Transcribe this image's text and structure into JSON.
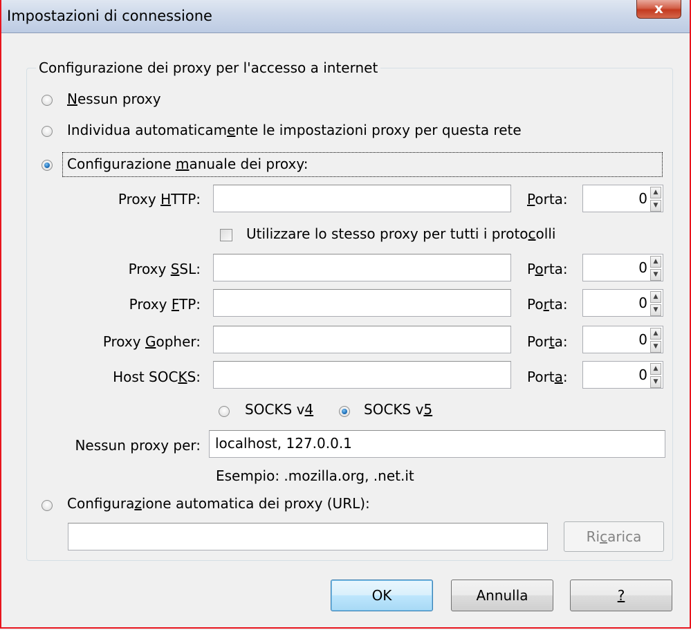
{
  "window": {
    "title": "Impostazioni di connessione",
    "close_glyph": "x"
  },
  "group": {
    "legend": "Configurazione dei proxy per l'accesso a internet"
  },
  "options": {
    "no_proxy": {
      "pre": "",
      "key": "N",
      "post": "essun proxy",
      "checked": false
    },
    "auto_detect": {
      "pre": "Individua automaticam",
      "key": "e",
      "post": "nte le impostazioni proxy per questa rete",
      "checked": false
    },
    "manual": {
      "pre": "Configurazione ",
      "key": "m",
      "post": "anuale dei proxy:",
      "checked": true
    },
    "auto_url": {
      "pre": "Configura",
      "key": "z",
      "post": "ione automatica dei proxy (URL):",
      "checked": false
    }
  },
  "proxies": {
    "http": {
      "label_pre": "Proxy ",
      "label_key": "H",
      "label_post": "TTP:",
      "value": "",
      "port_pre": "",
      "port_key": "P",
      "port_post": "orta:",
      "port": "0"
    },
    "ssl": {
      "label_pre": "Proxy ",
      "label_key": "S",
      "label_post": "SL:",
      "value": "",
      "port_pre": "P",
      "port_key": "o",
      "port_post": "rta:",
      "port": "0"
    },
    "ftp": {
      "label_pre": "Proxy ",
      "label_key": "F",
      "label_post": "TP:",
      "value": "",
      "port_pre": "Po",
      "port_key": "r",
      "port_post": "ta:",
      "port": "0"
    },
    "gopher": {
      "label_pre": "Proxy ",
      "label_key": "G",
      "label_post": "opher:",
      "value": "",
      "port_pre": "Por",
      "port_key": "t",
      "port_post": "a:",
      "port": "0"
    },
    "socks": {
      "label_pre": "Host SOC",
      "label_key": "K",
      "label_post": "S:",
      "value": "",
      "port_pre": "Port",
      "port_key": "a",
      "port_post": ":",
      "port": "0"
    }
  },
  "same_proxy": {
    "pre": "Utilizzare lo stesso proxy per tutti i proto",
    "key": "c",
    "post": "olli",
    "checked": false
  },
  "socks_version": {
    "v4": {
      "pre": "SOCKS v",
      "key": "4",
      "checked": false
    },
    "v5": {
      "pre": "SOCKS v",
      "key": "5",
      "checked": true
    }
  },
  "no_proxy_for": {
    "label": "Nessun proxy per:",
    "value": "localhost, 127.0.0.1",
    "example": "Esempio: .mozilla.org, .net.it"
  },
  "auto_url": {
    "value": "",
    "reload_pre": "Ri",
    "reload_key": "c",
    "reload_post": "arica"
  },
  "buttons": {
    "ok": "OK",
    "cancel": "Annulla",
    "help_key": "?"
  },
  "colors": {
    "frame": "#e8141d",
    "default_button": "#3c7fb1",
    "radio_dot": "#1d6fb8"
  }
}
